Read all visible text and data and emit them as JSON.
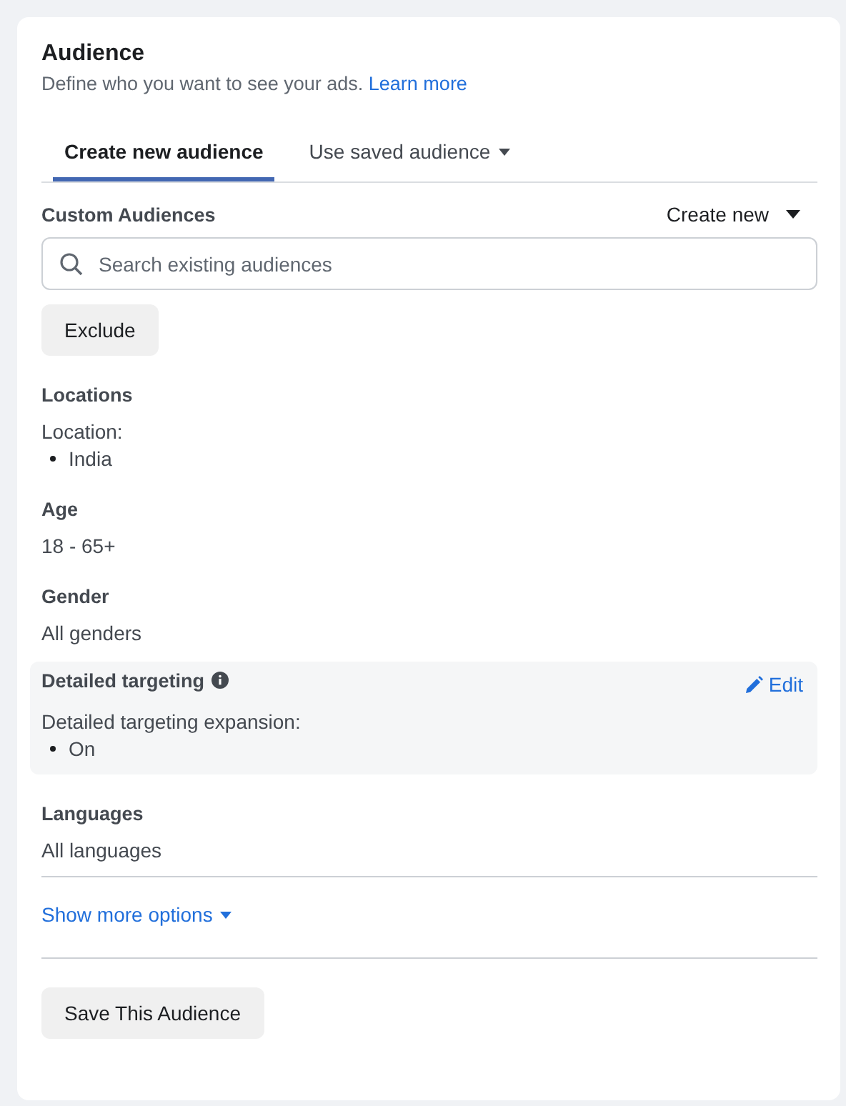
{
  "header": {
    "title": "Audience",
    "description": "Define who you want to see your ads.",
    "link": "Learn more"
  },
  "tabs": [
    {
      "label": "Create new audience",
      "selected": true,
      "dropdown": false
    },
    {
      "label": "Use saved audience",
      "selected": false,
      "dropdown": true
    }
  ],
  "custom_audiences": {
    "title": "Custom Audiences",
    "create_button": "Create new",
    "search": {
      "placeholder": "Search existing audiences"
    },
    "exclude_button": "Exclude"
  },
  "sections": [
    {
      "kind": "list",
      "title": "Locations",
      "label": "Location:",
      "items": [
        "India"
      ],
      "highlighted": false
    },
    {
      "kind": "text",
      "title": "Age",
      "value": "18 - 65+",
      "highlighted": false
    },
    {
      "kind": "text",
      "title": "Gender",
      "value": "All genders",
      "highlighted": false
    },
    {
      "kind": "list",
      "title": "Detailed targeting",
      "info": true,
      "edit": "Edit",
      "label": "Detailed targeting expansion:",
      "items": [
        "On"
      ],
      "highlighted": true
    },
    {
      "kind": "text",
      "title": "Languages",
      "value": "All languages",
      "highlighted": false
    }
  ],
  "show_more": "Show more options",
  "save_button": "Save This Audience"
}
